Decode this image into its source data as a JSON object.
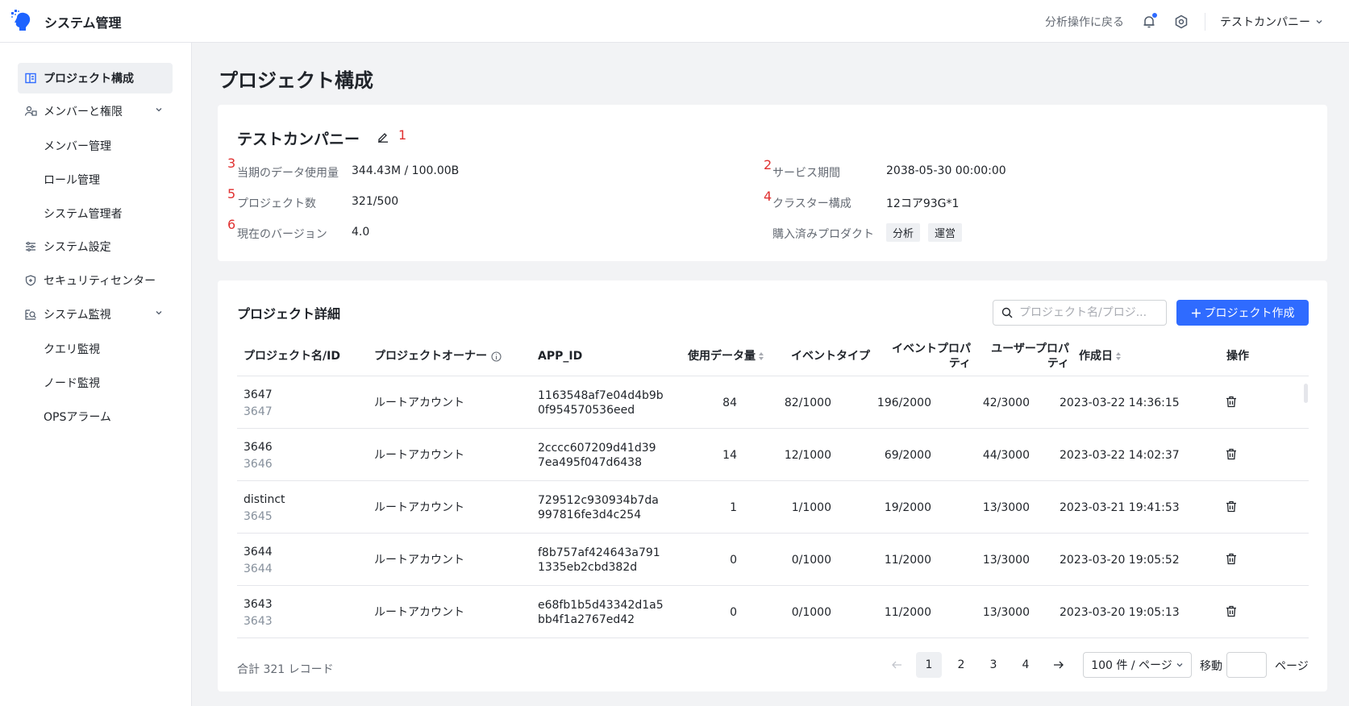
{
  "header": {
    "app_title": "システム管理",
    "back_link": "分析操作に戻る",
    "company": "テストカンパニー",
    "accent": "#2f6bff"
  },
  "sidebar": {
    "items": [
      {
        "label": "プロジェクト構成",
        "icon": "project-config-icon"
      },
      {
        "label": "メンバーと権限",
        "icon": "members-icon"
      },
      {
        "label": "メンバー管理"
      },
      {
        "label": "ロール管理"
      },
      {
        "label": "システム管理者"
      },
      {
        "label": "システム設定",
        "icon": "sliders-icon"
      },
      {
        "label": "セキュリティセンター",
        "icon": "shield-icon"
      },
      {
        "label": "システム監視",
        "icon": "monitor-icon"
      },
      {
        "label": "クエリ監視"
      },
      {
        "label": "ノード監視"
      },
      {
        "label": "OPSアラーム"
      }
    ]
  },
  "page_title": "プロジェクト構成",
  "info": {
    "company_name": "テストカンパニー",
    "markers": [
      "1",
      "2",
      "3",
      "4",
      "5",
      "6"
    ],
    "data_usage_label": "当期のデータ使用量",
    "data_usage_value": "344.43M / 100.00B",
    "project_count_label": "プロジェクト数",
    "project_count_value": "321/500",
    "version_label": "現在のバージョン",
    "version_value": "4.0",
    "service_period_label": "サービス期間",
    "service_period_value": "2038-05-30 00:00:00",
    "cluster_label": "クラスター構成",
    "cluster_value": "12コア93G*1",
    "products_label": "購入済みプロダクト",
    "products": [
      "分析",
      "運営"
    ]
  },
  "table": {
    "title": "プロジェクト詳細",
    "search_placeholder": "プロジェクト名/プロジ...",
    "create_button": "プロジェクト作成",
    "columns": {
      "name": "プロジェクト名/ID",
      "owner": "プロジェクトオーナー",
      "app_id": "APP_ID",
      "usage": "使用データ量",
      "event_type": "イベントタイプ",
      "event_prop_1": "イベントプロパ",
      "event_prop_2": "ティ",
      "user_prop_1": "ユーザープロパ",
      "user_prop_2": "ティ",
      "created": "作成日",
      "ops": "操作"
    },
    "rows": [
      {
        "name": "3647",
        "id": "3647",
        "owner": "ルートアカウント",
        "app1": "1163548af7e04d4b9b",
        "app2": "0f954570536eed",
        "usage": "84",
        "event_type": "82/1000",
        "event_prop": "196/2000",
        "user_prop": "42/3000",
        "created": "2023-03-22 14:36:15"
      },
      {
        "name": "3646",
        "id": "3646",
        "owner": "ルートアカウント",
        "app1": "2cccc607209d41d39",
        "app2": "7ea495f047d6438",
        "usage": "14",
        "event_type": "12/1000",
        "event_prop": "69/2000",
        "user_prop": "44/3000",
        "created": "2023-03-22 14:02:37"
      },
      {
        "name": "distinct",
        "id": "3645",
        "owner": "ルートアカウント",
        "app1": "729512c930934b7da",
        "app2": "997816fe3d4c254",
        "usage": "1",
        "event_type": "1/1000",
        "event_prop": "19/2000",
        "user_prop": "13/3000",
        "created": "2023-03-21 19:41:53"
      },
      {
        "name": "3644",
        "id": "3644",
        "owner": "ルートアカウント",
        "app1": "f8b757af424643a791",
        "app2": "1335eb2cbd382d",
        "usage": "0",
        "event_type": "0/1000",
        "event_prop": "11/2000",
        "user_prop": "13/3000",
        "created": "2023-03-20 19:05:52"
      },
      {
        "name": "3643",
        "id": "3643",
        "owner": "ルートアカウント",
        "app1": "e68fb1b5d43342d1a5",
        "app2": "bb4f1a2767ed42",
        "usage": "0",
        "event_type": "0/1000",
        "event_prop": "11/2000",
        "user_prop": "13/3000",
        "created": "2023-03-20 19:05:13"
      }
    ],
    "total": "合計 321 レコード",
    "pages": [
      "1",
      "2",
      "3",
      "4"
    ],
    "current_page": "1",
    "page_size": "100 件 / ページ",
    "goto_label": "移動",
    "page_unit": "ページ"
  }
}
